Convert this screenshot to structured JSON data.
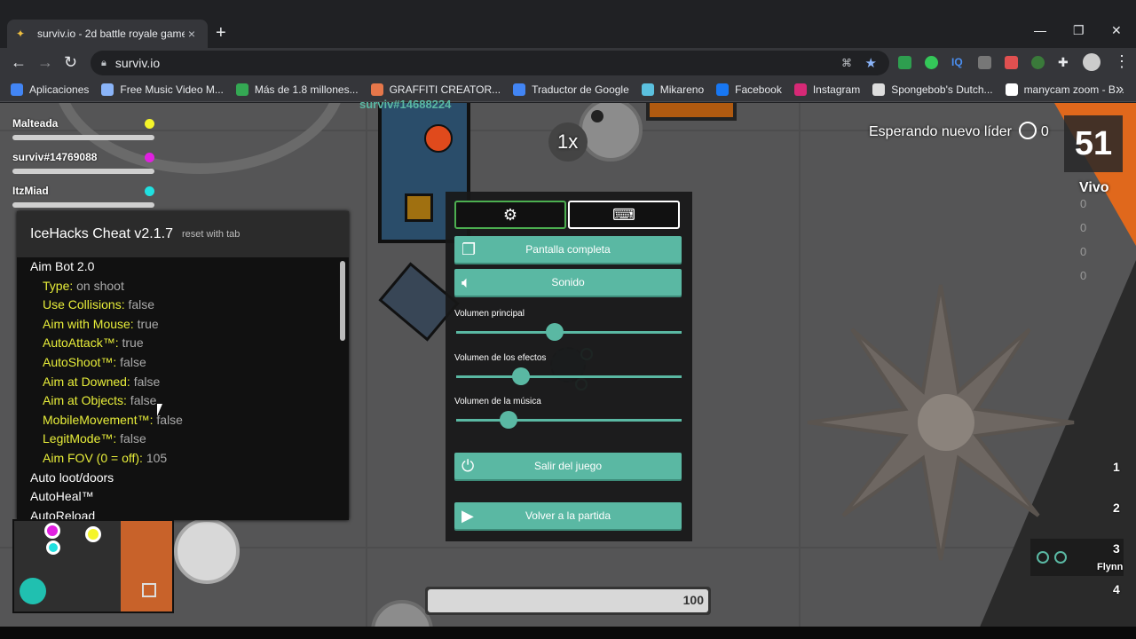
{
  "browser": {
    "tab_title": "surviv.io - 2d battle royale game",
    "tab_close": "×",
    "new_tab": "+",
    "url": "surviv.io",
    "bookmarks": [
      {
        "label": "Aplicaciones",
        "color": "#4285f4"
      },
      {
        "label": "Free Music Video M...",
        "color": "#8ab4f8"
      },
      {
        "label": "Más de 1.8 millones...",
        "color": "#34a853"
      },
      {
        "label": "GRAFFITI CREATOR...",
        "color": "#e6774a"
      },
      {
        "label": "Traductor de Google",
        "color": "#4285f4"
      },
      {
        "label": "Mikareno",
        "color": "#5bc0de"
      },
      {
        "label": "Facebook",
        "color": "#1877f2"
      },
      {
        "label": "Instagram",
        "color": "#d62976"
      },
      {
        "label": "Spongebob's Dutch...",
        "color": "#dddddd"
      },
      {
        "label": "manycam zoom - B...",
        "color": "#ffffff"
      }
    ]
  },
  "players": [
    {
      "name": "Malteada",
      "color": "#f5f52a"
    },
    {
      "name": "surviv#14769088",
      "color": "#e020e0"
    },
    {
      "name": "ItzMiad",
      "color": "#20e0e0"
    }
  ],
  "cheat": {
    "title": "IceHacks Cheat v2.1.7",
    "subtitle": "reset with tab",
    "rows": [
      {
        "level": "top",
        "key": "Aim Bot 2.0",
        "value": ""
      },
      {
        "level": "sub",
        "key": "Type:",
        "value": " on shoot"
      },
      {
        "level": "sub",
        "key": "Use Collisions:",
        "value": " false"
      },
      {
        "level": "sub",
        "key": "Aim with Mouse:",
        "value": " true"
      },
      {
        "level": "sub",
        "key": "AutoAttack™:",
        "value": " true"
      },
      {
        "level": "sub",
        "key": "AutoShoot™:",
        "value": " false"
      },
      {
        "level": "sub",
        "key": "Aim at Downed:",
        "value": " false"
      },
      {
        "level": "sub",
        "key": "Aim at Objects:",
        "value": " false"
      },
      {
        "level": "sub",
        "key": "MobileMovement™:",
        "value": " false"
      },
      {
        "level": "sub",
        "key": "LegitMode™:",
        "value": " false"
      },
      {
        "level": "sub",
        "key": "Aim FOV (0 = off):",
        "value": " 105"
      },
      {
        "level": "top",
        "key": "Auto loot/doors",
        "value": ""
      },
      {
        "level": "top",
        "key": "AutoHeal™",
        "value": ""
      },
      {
        "level": "top",
        "key": "AutoReload",
        "value": ""
      }
    ]
  },
  "menu": {
    "settings_icon": "gear-icon",
    "keyboard_icon": "keyboard-icon",
    "fullscreen": "Pantalla completa",
    "sound": "Sonido",
    "vol_main": "Volumen principal",
    "vol_effects": "Volumen de los efectos",
    "vol_music": "Volumen de la música",
    "vol_main_level": 0.43,
    "vol_effects_level": 0.27,
    "vol_music_level": 0.21,
    "quit": "Salir del juego",
    "resume": "Volver a la partida"
  },
  "hud": {
    "leader_text": "Esperando nuevo líder",
    "leader_kills": "0",
    "alive_count": "51",
    "alive_label": "Vivo",
    "zoom": "1x",
    "ammo": [
      "0",
      "0",
      "0",
      "0"
    ],
    "slots": [
      "1",
      "2",
      "3",
      "4"
    ],
    "slot3_weapon": "Flynn",
    "health": "100",
    "health_fraction": 1.0,
    "top_player_tag": "surviv#14688224"
  }
}
